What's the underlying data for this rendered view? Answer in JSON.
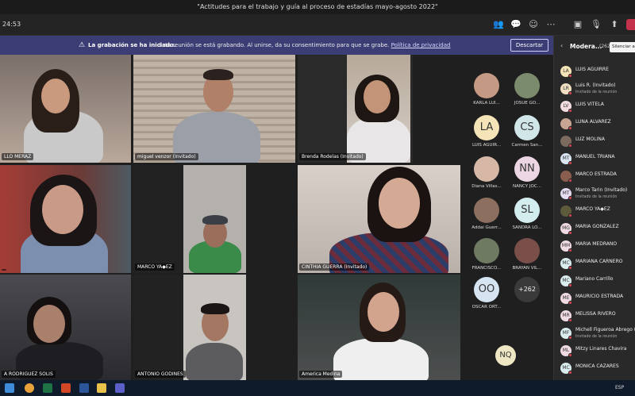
{
  "window": {
    "title": "\"Actitudes para el trabajo y guía al proceso de estadías mayo-agosto 2022\""
  },
  "toolbar": {
    "timer": "24:53"
  },
  "banner": {
    "bold": "La grabación se ha iniciado.",
    "message": "Esta reunión se está grabando. Al unirse, da su consentimiento para que se grabe.",
    "link": "Política de privacidad",
    "dismiss_label": "Descartar"
  },
  "tiles": [
    {
      "name": "LLO MERAZ"
    },
    {
      "name": "miguel venzor (Invitado)"
    },
    {
      "name": "Brenda Rodelas (Invitado)"
    },
    {
      "name": ""
    },
    {
      "name": "MARCO YA◆EZ"
    },
    {
      "name": "CINTHIA GUERRA (Invitado)"
    },
    {
      "name": "A RODRIGUEZ SOLIS"
    },
    {
      "name": "ANTONIO GODINES"
    },
    {
      "name": "America Medina"
    }
  ],
  "gallery": [
    {
      "name": "KARLA LUI...",
      "initials": ""
    },
    {
      "name": "JOSUE GO...",
      "initials": ""
    },
    {
      "name": "LUIS AGUIR...",
      "initials": "LA"
    },
    {
      "name": "Carmen San...",
      "initials": "CS"
    },
    {
      "name": "Diana Villas...",
      "initials": ""
    },
    {
      "name": "NANCY JOC...",
      "initials": "NN"
    },
    {
      "name": "Addai Guerr...",
      "initials": ""
    },
    {
      "name": "SANDRA LO...",
      "initials": "SL"
    },
    {
      "name": "FRANCISCO...",
      "initials": ""
    },
    {
      "name": "BRAYAN VIL...",
      "initials": ""
    },
    {
      "name": "OSCAR ORT...",
      "initials": "OO"
    },
    {
      "name": "",
      "initials": "+262"
    }
  ],
  "gallery_extra": {
    "initials": "NQ"
  },
  "panel": {
    "title": "Modera...",
    "count": "(262)",
    "mute_all": "Silenciar a todos",
    "participants": [
      {
        "name": "LUIS AGUIRRE",
        "initials": "LA",
        "sub": ""
      },
      {
        "name": "Luis R. (Invitado)",
        "initials": "LR",
        "sub": "Invitado de la reunión"
      },
      {
        "name": "LUIS VITELA",
        "initials": "LV",
        "sub": ""
      },
      {
        "name": "LUNA ALVAREZ",
        "initials": "",
        "sub": ""
      },
      {
        "name": "LUZ MOLINA",
        "initials": "",
        "sub": ""
      },
      {
        "name": "MANUEL TRIANA",
        "initials": "MT",
        "sub": ""
      },
      {
        "name": "MARCO ESTRADA",
        "initials": "",
        "sub": ""
      },
      {
        "name": "Marco Tarin (Invitado)",
        "initials": "MT",
        "sub": "Invitado de la reunión"
      },
      {
        "name": "MARCO YA◆EZ",
        "initials": "",
        "sub": ""
      },
      {
        "name": "MARIA GONZALEZ",
        "initials": "MG",
        "sub": ""
      },
      {
        "name": "MARIA MEDRANO",
        "initials": "MM",
        "sub": ""
      },
      {
        "name": "MARIANA CARNERO",
        "initials": "MC",
        "sub": ""
      },
      {
        "name": "Mariano Carrillo",
        "initials": "MC",
        "sub": ""
      },
      {
        "name": "MAURICIO ESTRADA",
        "initials": "ME",
        "sub": ""
      },
      {
        "name": "MELISSA RIVERO",
        "initials": "MR",
        "sub": ""
      },
      {
        "name": "Michell Figueroa Abrego (Inv",
        "initials": "MF",
        "sub": "Invitado de la reunión"
      },
      {
        "name": "Mitzy Linares Chavira",
        "initials": "ML",
        "sub": ""
      },
      {
        "name": "MONICA CAZARES",
        "initials": "MC",
        "sub": ""
      }
    ]
  },
  "taskbar": {
    "lang": "ESP"
  }
}
